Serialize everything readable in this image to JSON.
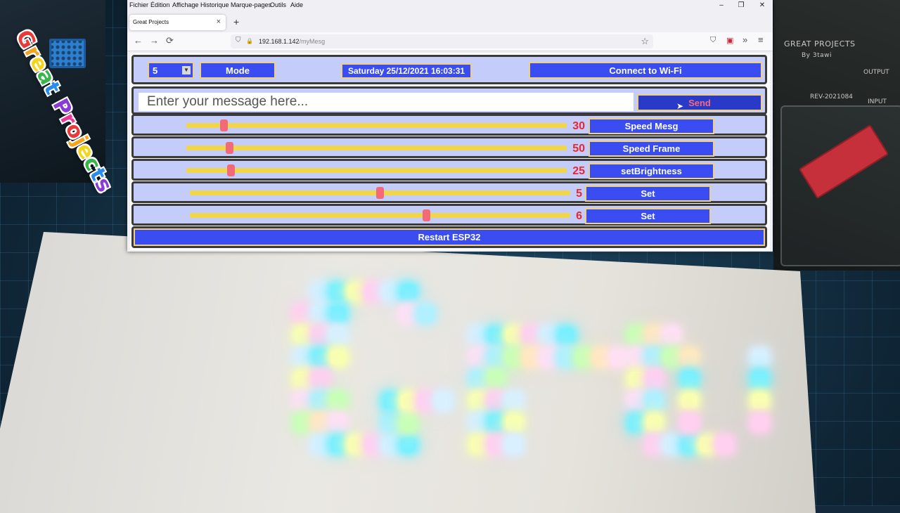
{
  "browser": {
    "menu": [
      "Fichier",
      "Édition",
      "Affichage",
      "Historique",
      "Marque-pages",
      "Outils",
      "Aide"
    ],
    "tab_title": "Great Projects",
    "url_host": "192.168.1.142",
    "url_path": "/myMesg",
    "icons": {
      "back": "←",
      "forward": "→",
      "reload": "⟳",
      "shield": "⛉",
      "lock": "🔒",
      "star": "☆",
      "pocket": "⛉",
      "extension": "▣",
      "more": "»",
      "menu": "≡",
      "new_tab": "+",
      "tab_close": "×",
      "minimize": "–",
      "maximize": "❐",
      "close": "✕"
    }
  },
  "header": {
    "mode_value": "5",
    "mode_button": "Mode",
    "datetime": "Saturday 25/12/2021 16:03:31",
    "wifi_button": "Connect to Wi-Fi"
  },
  "message": {
    "placeholder": "Enter your message here...",
    "send_button": "Send"
  },
  "sliders": [
    {
      "value": "30",
      "label": "Speed Mesg",
      "level": 0.09
    },
    {
      "value": "50",
      "label": "Speed Frame",
      "level": 0.105
    },
    {
      "value": "25",
      "label": "setBrightness",
      "level": 0.11
    },
    {
      "value": "5",
      "label": "Set",
      "level": 0.5
    },
    {
      "value": "6",
      "label": "Set",
      "level": 0.625
    }
  ],
  "restart_button": "Restart ESP32",
  "background": {
    "board_title": "GREAT PROJECTS",
    "board_by": "By 3tawi",
    "board_output": "OUTPUT",
    "board_input": "INPUT",
    "board_rev": "REV-2021084",
    "brand_text": "Great Projects"
  },
  "colors": {
    "button_blue": "#3a4df0",
    "row_bg": "#c4ccfa",
    "slider_track": "#f2d64a",
    "slider_thumb": "#f26a78",
    "value_red": "#e8282e"
  }
}
